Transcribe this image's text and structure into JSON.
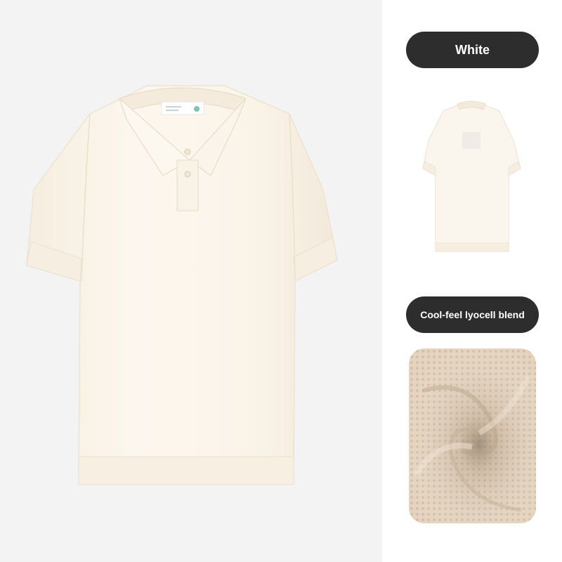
{
  "color_label": "White",
  "fabric_label": "Cool-feel lyocell blend",
  "colors": {
    "dark_pill": "#2d2d2d",
    "shirt": "#fbf5ea",
    "fabric": "#e2d2bd",
    "background": "#f3f3f3"
  },
  "icons": {
    "main_image": "polo-shirt-front",
    "back_image": "polo-shirt-back",
    "texture_image": "knit-fabric-swirl"
  }
}
